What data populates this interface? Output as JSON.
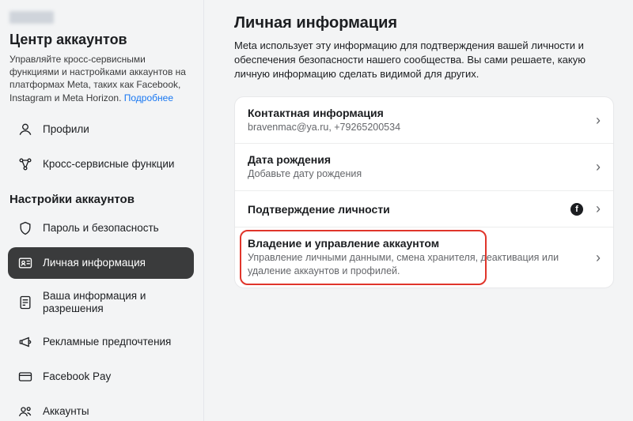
{
  "sidebar": {
    "title": "Центр аккаунтов",
    "description_pre": "Управляйте кросс-сервисными функциями и настройками аккаунтов на платформах Meta, таких как Facebook, Instagram и Meta Horizon. ",
    "description_link": "Подробнее",
    "top_items": [
      {
        "label": "Профили"
      },
      {
        "label": "Кросс-сервисные функции"
      }
    ],
    "section_label": "Настройки аккаунтов",
    "items": [
      {
        "label": "Пароль и безопасность"
      },
      {
        "label": "Личная информация"
      },
      {
        "label": "Ваша информация и разрешения"
      },
      {
        "label": "Рекламные предпочтения"
      },
      {
        "label": "Facebook Pay"
      },
      {
        "label": "Аккаунты"
      }
    ]
  },
  "main": {
    "title": "Личная информация",
    "description": "Meta использует эту информацию для подтверждения вашей личности и обеспечения безопасности нашего сообщества. Вы сами решаете, какую личную информацию сделать видимой для других.",
    "rows": {
      "contact": {
        "title": "Контактная информация",
        "sub": "bravenmac@ya.ru, +79265200534"
      },
      "dob": {
        "title": "Дата рождения",
        "sub": "Добавьте дату рождения"
      },
      "identity": {
        "title": "Подтверждение личности"
      },
      "ownership": {
        "title": "Владение и управление аккаунтом",
        "sub": "Управление личными данными, смена хранителя, деактивация или удаление аккаунтов и профилей."
      }
    }
  }
}
